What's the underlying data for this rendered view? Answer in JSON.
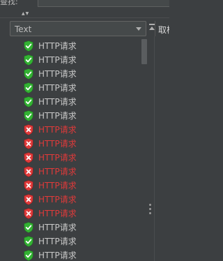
{
  "header": {
    "label": "查找:",
    "search_value": ""
  },
  "filter_combo": {
    "selected": "Text"
  },
  "side_tab": {
    "label": "取样"
  },
  "results": [
    {
      "label": "HTTP请求",
      "status": "success",
      "icon": "check-shield-icon"
    },
    {
      "label": "HTTP请求",
      "status": "success",
      "icon": "check-shield-icon"
    },
    {
      "label": "HTTP请求",
      "status": "success",
      "icon": "check-shield-icon"
    },
    {
      "label": "HTTP请求",
      "status": "success",
      "icon": "check-shield-icon"
    },
    {
      "label": "HTTP请求",
      "status": "success",
      "icon": "check-shield-icon"
    },
    {
      "label": "HTTP请求",
      "status": "success",
      "icon": "check-shield-icon"
    },
    {
      "label": "HTTP请求",
      "status": "error",
      "icon": "error-shield-icon"
    },
    {
      "label": "HTTP请求",
      "status": "error",
      "icon": "error-shield-icon"
    },
    {
      "label": "HTTP请求",
      "status": "error",
      "icon": "error-shield-icon"
    },
    {
      "label": "HTTP请求",
      "status": "error",
      "icon": "error-shield-icon"
    },
    {
      "label": "HTTP请求",
      "status": "error",
      "icon": "error-shield-icon"
    },
    {
      "label": "HTTP请求",
      "status": "error",
      "icon": "error-shield-icon"
    },
    {
      "label": "HTTP请求",
      "status": "error",
      "icon": "error-shield-icon"
    },
    {
      "label": "HTTP请求",
      "status": "success",
      "icon": "check-shield-icon"
    },
    {
      "label": "HTTP请求",
      "status": "success",
      "icon": "check-shield-icon"
    },
    {
      "label": "HTTP请求",
      "status": "success",
      "icon": "check-shield-icon"
    }
  ],
  "colors": {
    "success": "#33b233",
    "error": "#e03a3a",
    "background": "#3c3f41"
  }
}
